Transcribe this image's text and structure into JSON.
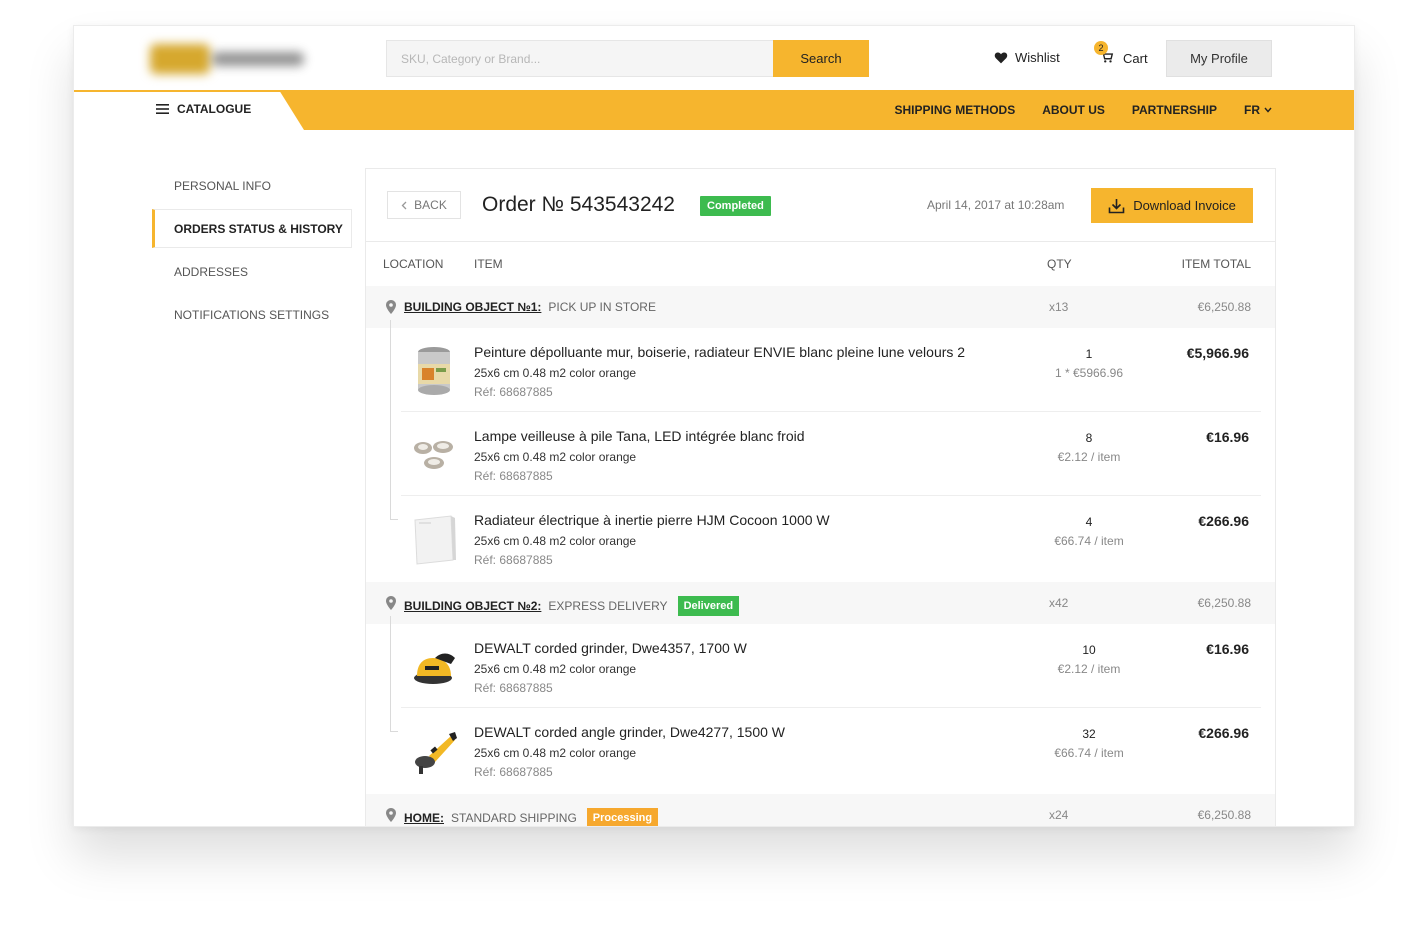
{
  "header": {
    "search_placeholder": "SKU, Category or Brand...",
    "search_button": "Search",
    "wishlist": "Wishlist",
    "cart": "Cart",
    "cart_count": "2",
    "profile": "My Profile"
  },
  "menubar": {
    "catalogue": "CATALOGUE",
    "links": [
      "SHIPPING METHODS",
      "ABOUT US",
      "PARTNERSHIP",
      "FR"
    ]
  },
  "sidebar": {
    "items": [
      "PERSONAL INFO",
      "ORDERS STATUS & HISTORY",
      "ADDRESSES",
      "NOTIFICATIONS SETTINGS"
    ],
    "active_index": 1
  },
  "order": {
    "back": "BACK",
    "title": "Order № 543543242",
    "status": "Completed",
    "date": "April 14, 2017 at 10:28am",
    "download": "Download Invoice"
  },
  "columns": {
    "location": "LOCATION",
    "item": "ITEM",
    "qty": "QTY",
    "total": "ITEM TOTAL"
  },
  "groups": [
    {
      "name": "BUILDING OBJECT №1:",
      "shipping": "PICK UP IN STORE",
      "badge": "",
      "qty": "x13",
      "total": "€6,250.88",
      "items": [
        {
          "name": "Peinture dépolluante mur, boiserie, radiateur ENVIE blanc pleine lune velours 2",
          "desc": "25x6 cm 0.48 m2 color orange",
          "ref": "Réf: 68687885",
          "qty": "1",
          "unit": "1 * €5966.96",
          "total": "€5,966.96",
          "icon": "paint-can-icon"
        },
        {
          "name": "Lampe veilleuse à pile Tana, LED intégrée blanc froid",
          "desc": "25x6 cm 0.48 m2 color orange",
          "ref": "Réf: 68687885",
          "qty": "8",
          "unit": "€2.12 / item",
          "total": "€16.96",
          "icon": "led-lamp-icon"
        },
        {
          "name": "Radiateur électrique à inertie pierre HJM Cocoon 1000 W",
          "desc": "25x6 cm 0.48 m2 color orange",
          "ref": "Réf: 68687885",
          "qty": "4",
          "unit": "€66.74 / item",
          "total": "€266.96",
          "icon": "radiator-icon"
        }
      ]
    },
    {
      "name": "BUILDING OBJECT №2:",
      "shipping": "EXPRESS DELIVERY",
      "badge": "Delivered",
      "qty": "x42",
      "total": "€6,250.88",
      "items": [
        {
          "name": "DEWALT corded grinder, Dwe4357, 1700 W",
          "desc": "25x6 cm 0.48 m2 color orange",
          "ref": "Réf: 68687885",
          "qty": "10",
          "unit": "€2.12 / item",
          "total": "€16.96",
          "icon": "orbital-sander-icon"
        },
        {
          "name": "DEWALT corded angle grinder, Dwe4277, 1500 W",
          "desc": "25x6 cm 0.48 m2 color orange",
          "ref": "Réf: 68687885",
          "qty": "32",
          "unit": "€66.74 / item",
          "total": "€266.96",
          "icon": "angle-grinder-icon"
        }
      ]
    },
    {
      "name": "HOME:",
      "shipping": "STANDARD SHIPPING",
      "badge": "Processing",
      "qty": "x24",
      "total": "€6,250.88",
      "items": []
    }
  ],
  "colors": {
    "accent": "#f6b52e",
    "success": "#3dbb4f",
    "processing": "#f6a82e"
  }
}
